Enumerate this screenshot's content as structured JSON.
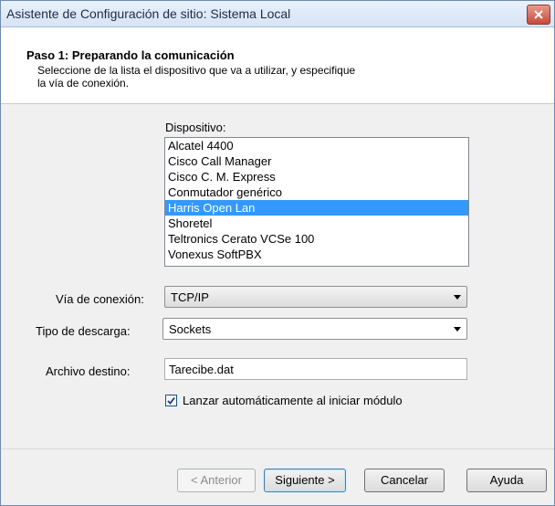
{
  "window": {
    "title": "Asistente de Configuración de sitio: Sistema Local",
    "close_icon": "close-icon"
  },
  "header": {
    "step_title": "Paso 1: Preparando la comunicación",
    "step_desc_line1": "Seleccione de la lista el dispositivo que va a utilizar, y especifique",
    "step_desc_line2": "la vía de conexión."
  },
  "device": {
    "label": "Dispositivo:",
    "items": [
      {
        "label": "Alcatel 4400",
        "selected": false
      },
      {
        "label": "Cisco Call Manager",
        "selected": false
      },
      {
        "label": "Cisco C. M. Express",
        "selected": false
      },
      {
        "label": "Conmutador genérico",
        "selected": false
      },
      {
        "label": "Harris Open Lan",
        "selected": true
      },
      {
        "label": "Shoretel",
        "selected": false
      },
      {
        "label": "Teltronics Cerato VCSe 100",
        "selected": false
      },
      {
        "label": "Vonexus SoftPBX",
        "selected": false
      }
    ]
  },
  "connection": {
    "label": "Vía de conexión:",
    "value": "TCP/IP"
  },
  "download": {
    "label": "Tipo de descarga:",
    "value": "Sockets"
  },
  "target_file": {
    "label": "Archivo destino:",
    "value": "Tarecibe.dat"
  },
  "autolaunch": {
    "label": "Lanzar automáticamente al iniciar módulo",
    "checked": true
  },
  "buttons": {
    "back": "< Anterior",
    "next": "Siguiente >",
    "cancel": "Cancelar",
    "help": "Ayuda"
  }
}
